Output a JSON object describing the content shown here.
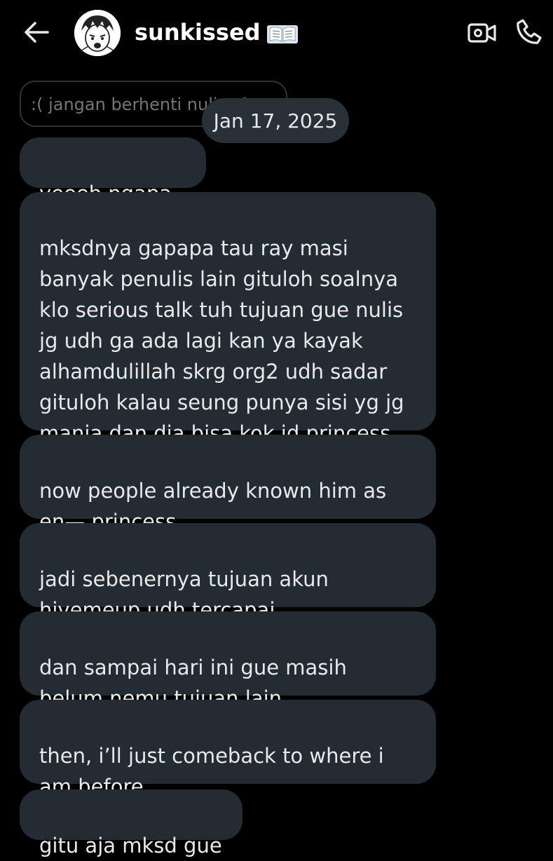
{
  "header": {
    "back_icon": "arrow-left-icon",
    "contact_name": "sunkissed",
    "name_emoji_icon": "open-book-icon",
    "video_icon": "video-camera-icon",
    "phone_icon": "phone-icon"
  },
  "reply_preview": {
    "text": ":( jangan berhenti nulis pls"
  },
  "date_label": "Jan 17, 2025",
  "messages": [
    {
      "text": "yeeeh ngapa 😭"
    },
    {
      "text": "mksdnya gapapa tau ray masi\nbanyak penulis lain gituloh soalnya\nklo serious talk tuh tujuan gue nulis\njg udh ga ada lagi kan ya kayak\nalhamdulillah skrg org2 udh sadar\ngituloh kalau seung punya sisi yg jg\nmanja dan dia bisa kok jd princess"
    },
    {
      "text": "now people already known him as\nen— princess"
    },
    {
      "text": "jadi sebenernya tujuan akun\nhivemeup udh tercapai"
    },
    {
      "text": "dan sampai hari ini gue masih\nbelum nemu tujuan lain"
    },
    {
      "text": "then, i’ll just comeback to where i\nam before"
    },
    {
      "text": "gitu aja mksd gue"
    }
  ],
  "colors": {
    "background": "#000000",
    "bubble": "#232b33",
    "date_pill": "#283038",
    "text": "#e7e9ea",
    "muted": "#71767b"
  }
}
